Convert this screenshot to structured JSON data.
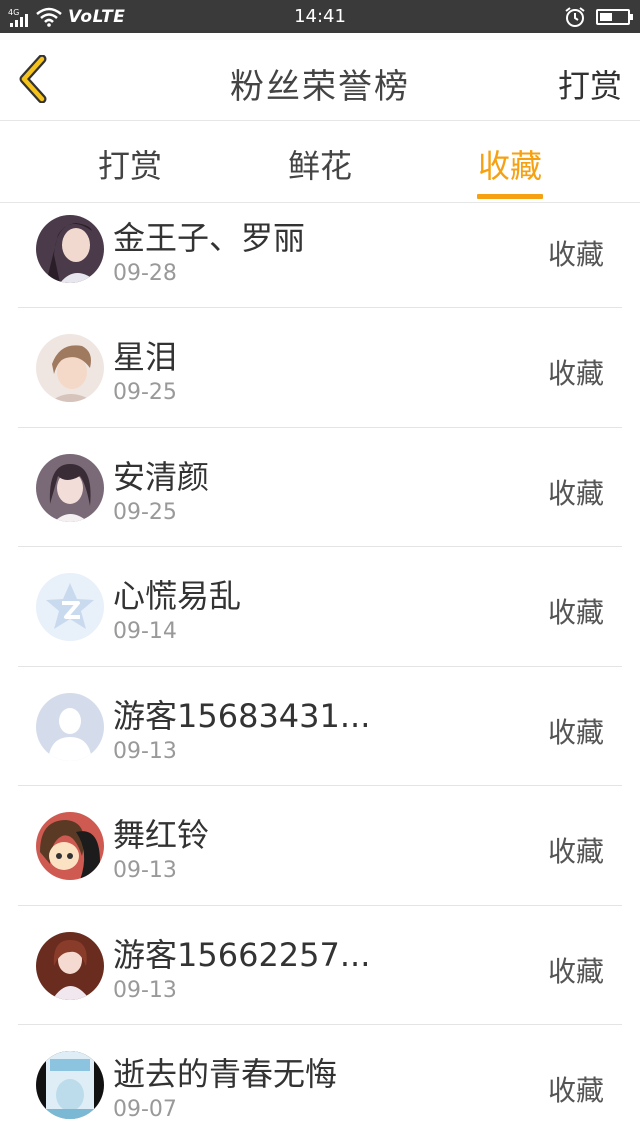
{
  "status_bar": {
    "network": "4G",
    "volte": "VoLTE",
    "time": "14:41"
  },
  "header": {
    "title": "粉丝荣誉榜",
    "action": "打赏",
    "accent_color": "#f6a111"
  },
  "tabs": [
    {
      "label": "打赏",
      "active": false
    },
    {
      "label": "鲜花",
      "active": false
    },
    {
      "label": "收藏",
      "active": true
    }
  ],
  "items": [
    {
      "name": "金王子、罗丽",
      "date": "09-28",
      "action": "收藏",
      "avatar": "girl-photo-avatar"
    },
    {
      "name": "星泪",
      "date": "09-25",
      "action": "收藏",
      "avatar": "boy-photo-avatar"
    },
    {
      "name": "安清颜",
      "date": "09-25",
      "action": "收藏",
      "avatar": "girl-photo-avatar"
    },
    {
      "name": "心慌易乱",
      "date": "09-14",
      "action": "收藏",
      "avatar": "qzone-logo-avatar"
    },
    {
      "name": "游客15683431...",
      "date": "09-13",
      "action": "收藏",
      "avatar": "default-user-avatar"
    },
    {
      "name": "舞红铃",
      "date": "09-13",
      "action": "收藏",
      "avatar": "anime-avatar"
    },
    {
      "name": "游客15662257...",
      "date": "09-13",
      "action": "收藏",
      "avatar": "girl-photo-avatar"
    },
    {
      "name": "逝去的青春无悔",
      "date": "09-07",
      "action": "收藏",
      "avatar": "book-cover-avatar"
    }
  ]
}
